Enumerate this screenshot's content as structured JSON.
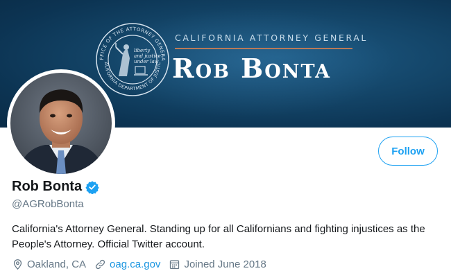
{
  "banner": {
    "subtitle": "CALIFORNIA ATTORNEY GENERAL",
    "name": "Rob Bonta",
    "seal": {
      "ring_top": "OFFICE OF THE ATTORNEY GENERAL",
      "ring_bottom": "CALIFORNIA DEPARTMENT OF JUSTICE",
      "motto_1": "liberty",
      "motto_2": "and justice",
      "motto_3": "under law"
    }
  },
  "actions": {
    "follow_label": "Follow"
  },
  "profile": {
    "display_name": "Rob Bonta",
    "handle": "@AGRobBonta",
    "bio": "California's Attorney General. Standing up for all Californians and fighting injustices as the People's Attorney. Official Twitter account.",
    "location": "Oakland, CA",
    "website": "oag.ca.gov",
    "joined": "Joined June 2018"
  },
  "colors": {
    "accent": "#1da1f2",
    "banner": "#134467",
    "secondary_text": "#657786"
  },
  "icons": [
    "verified-badge-icon",
    "location-pin-icon",
    "link-icon",
    "calendar-icon"
  ]
}
